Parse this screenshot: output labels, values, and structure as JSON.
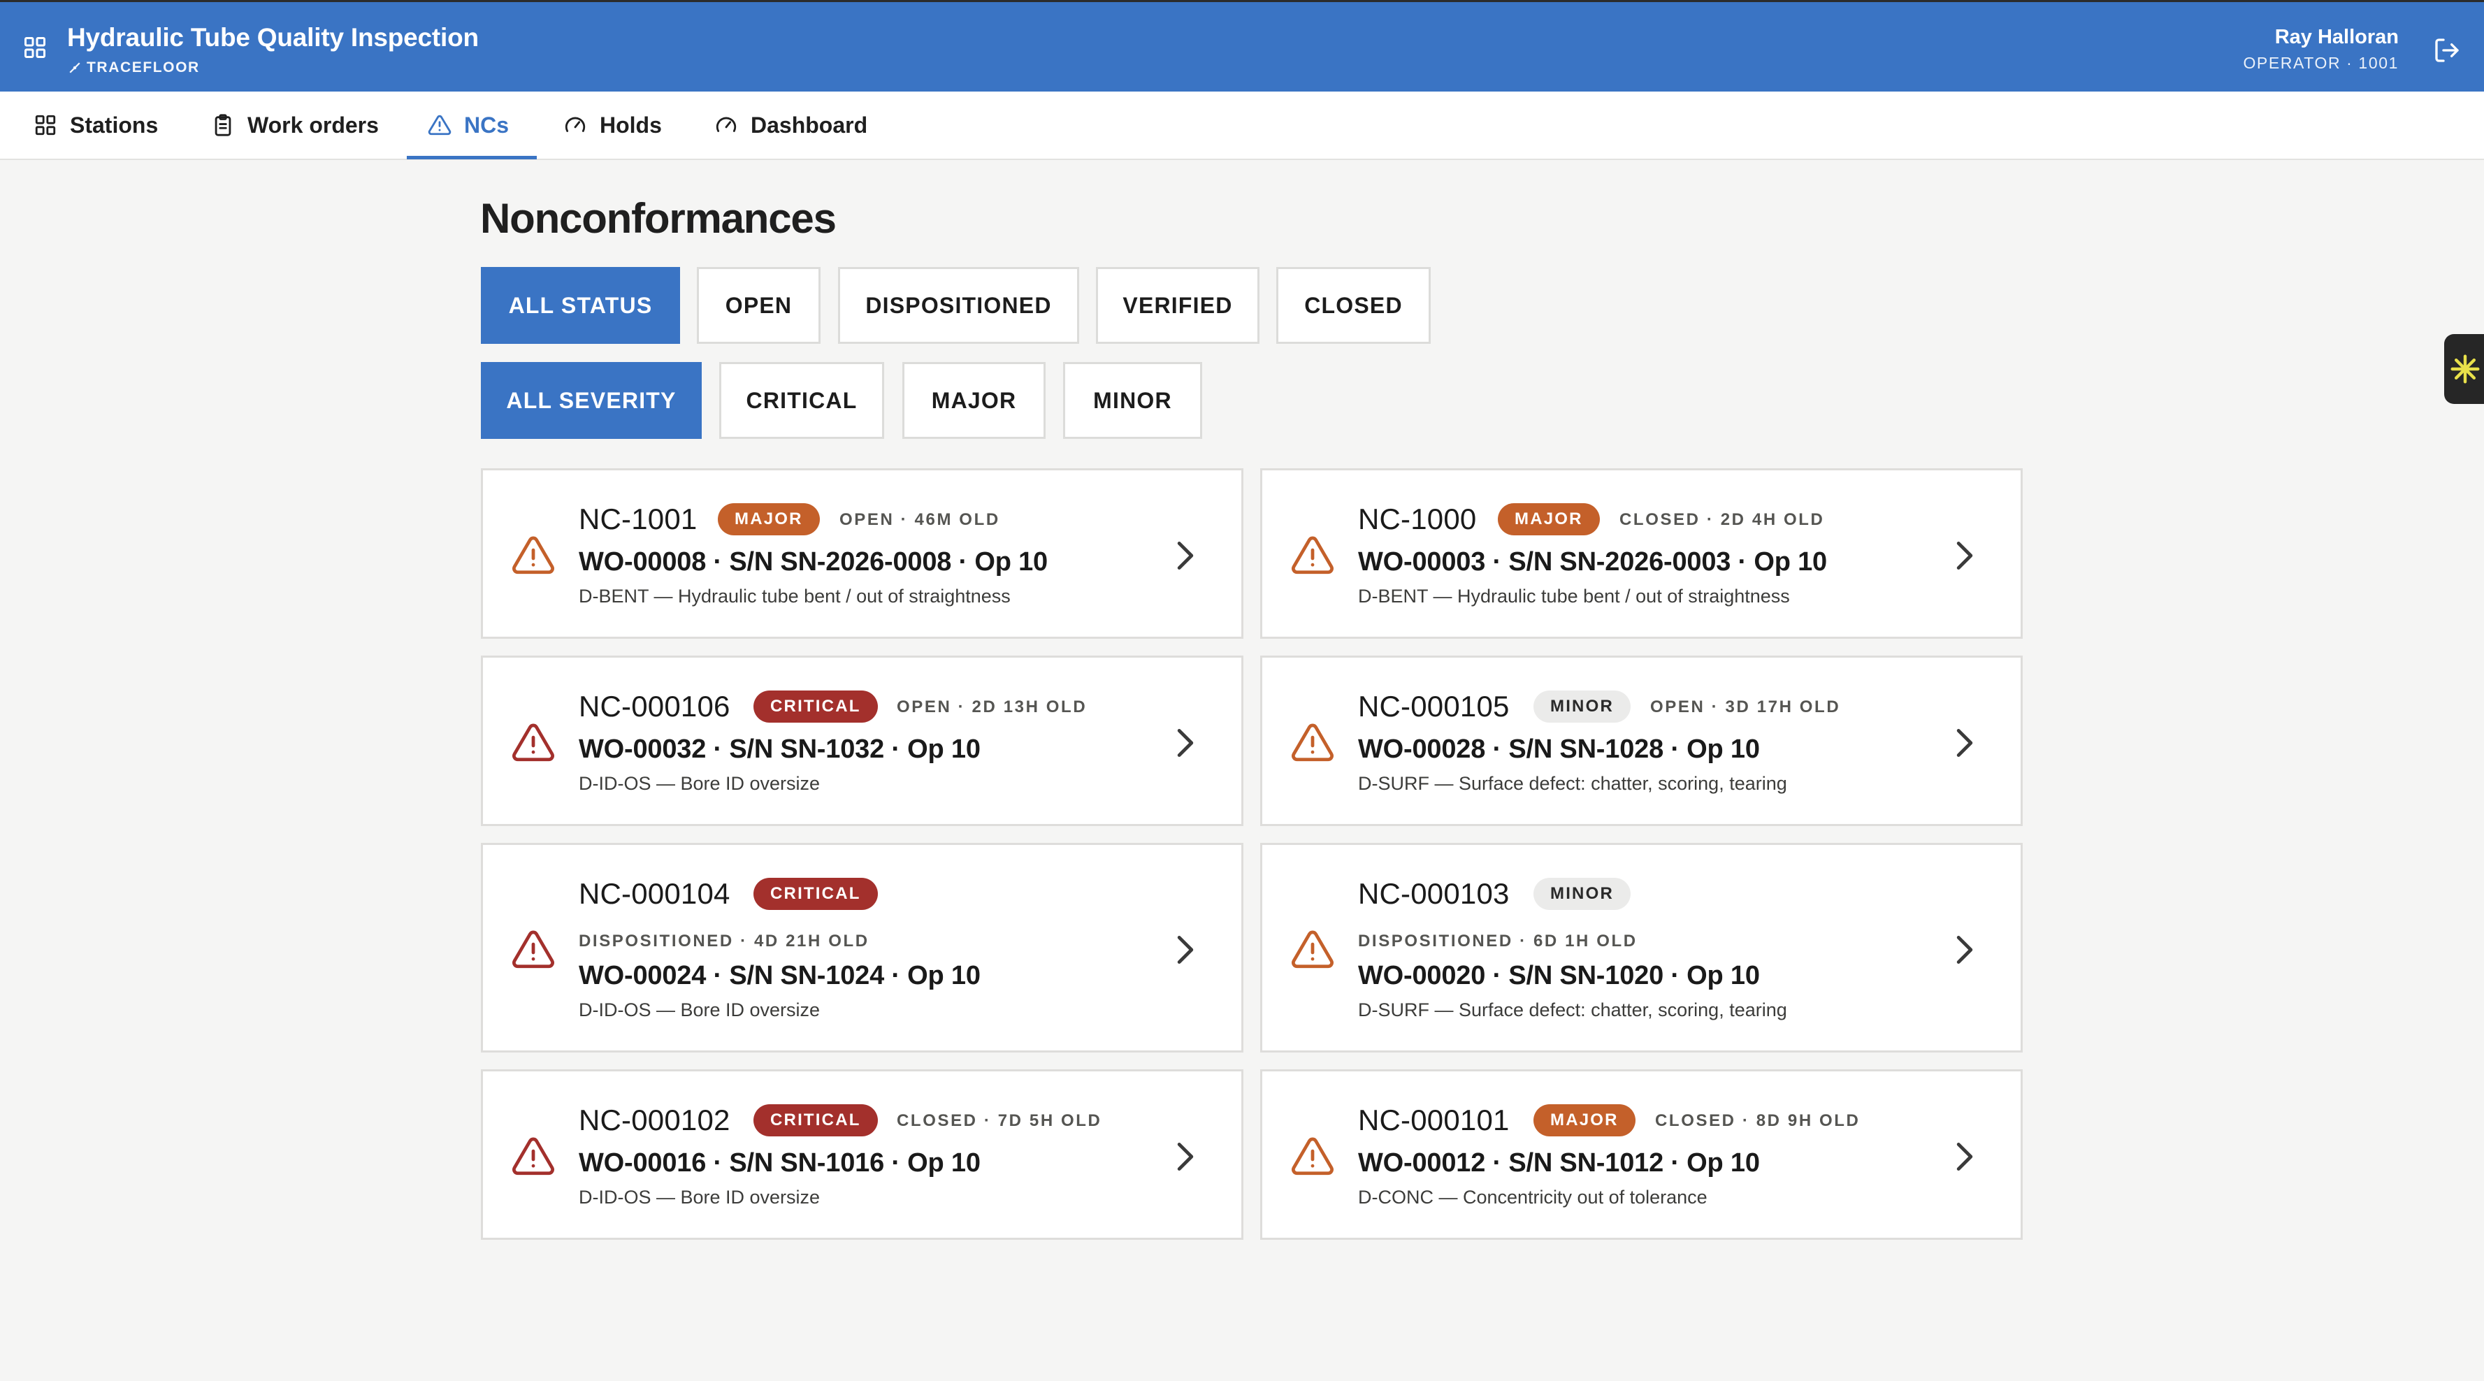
{
  "header": {
    "title": "Hydraulic Tube Quality Inspection",
    "subtitle": "TRACEFLOOR",
    "user_name": "Ray Halloran",
    "user_role": "OPERATOR · 1001"
  },
  "nav": {
    "tabs": [
      {
        "label": "Stations",
        "icon": "grid-icon"
      },
      {
        "label": "Work orders",
        "icon": "clipboard-icon"
      },
      {
        "label": "NCs",
        "icon": "warning-icon",
        "active": true
      },
      {
        "label": "Holds",
        "icon": "gauge-icon"
      },
      {
        "label": "Dashboard",
        "icon": "gauge-icon"
      }
    ]
  },
  "page": {
    "title": "Nonconformances",
    "status_filters": [
      "ALL STATUS",
      "OPEN",
      "DISPOSITIONED",
      "VERIFIED",
      "CLOSED"
    ],
    "status_selected": "ALL STATUS",
    "severity_filters": [
      "ALL SEVERITY",
      "CRITICAL",
      "MAJOR",
      "MINOR"
    ],
    "severity_selected": "ALL SEVERITY"
  },
  "ncs": [
    {
      "id": "NC-1001",
      "severity": "MAJOR",
      "status": "OPEN · 46M OLD",
      "wo": "WO-00008 · S/N SN-2026-0008 · Op 10",
      "defect": "D-BENT — Hydraulic tube bent / out of straightness"
    },
    {
      "id": "NC-1000",
      "severity": "MAJOR",
      "status": "CLOSED · 2D 4H OLD",
      "wo": "WO-00003 · S/N SN-2026-0003 · Op 10",
      "defect": "D-BENT — Hydraulic tube bent / out of straightness"
    },
    {
      "id": "NC-000106",
      "severity": "CRITICAL",
      "status": "OPEN · 2D 13H OLD",
      "wo": "WO-00032 · S/N SN-1032 · Op 10",
      "defect": "D-ID-OS — Bore ID oversize"
    },
    {
      "id": "NC-000105",
      "severity": "MINOR",
      "status": "OPEN · 3D 17H OLD",
      "wo": "WO-00028 · S/N SN-1028 · Op 10",
      "defect": "D-SURF — Surface defect: chatter, scoring, tearing"
    },
    {
      "id": "NC-000104",
      "severity": "CRITICAL",
      "status": "DISPOSITIONED · 4D 21H OLD",
      "wo": "WO-00024 · S/N SN-1024 · Op 10",
      "defect": "D-ID-OS — Bore ID oversize"
    },
    {
      "id": "NC-000103",
      "severity": "MINOR",
      "status": "DISPOSITIONED · 6D 1H OLD",
      "wo": "WO-00020 · S/N SN-1020 · Op 10",
      "defect": "D-SURF — Surface defect: chatter, scoring, tearing"
    },
    {
      "id": "NC-000102",
      "severity": "CRITICAL",
      "status": "CLOSED · 7D 5H OLD",
      "wo": "WO-00016 · S/N SN-1016 · Op 10",
      "defect": "D-ID-OS — Bore ID oversize"
    },
    {
      "id": "NC-000101",
      "severity": "MAJOR",
      "status": "CLOSED · 8D 9H OLD",
      "wo": "WO-00012 · S/N SN-1012 · Op 10",
      "defect": "D-CONC — Concentricity out of tolerance"
    }
  ],
  "colors": {
    "accent": "#3a74c4",
    "major": "#c4602a",
    "critical": "#a3302c",
    "minor": "#ebebea"
  }
}
